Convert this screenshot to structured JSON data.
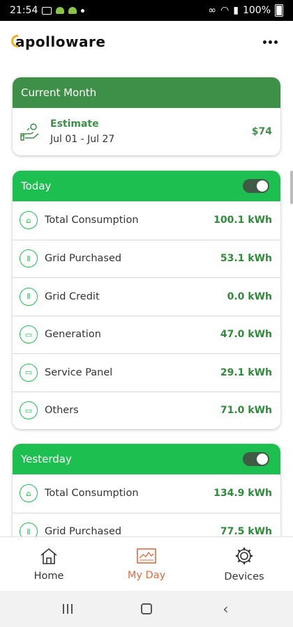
{
  "status_bar": {
    "time": "21:54",
    "battery": "100%"
  },
  "app": {
    "logo_text": "apolloware",
    "brand_color": "#f2b01e",
    "accent": "#3e8f47",
    "accent_bright": "#1cbf50"
  },
  "current_month": {
    "title": "Current Month",
    "estimate_label": "Estimate",
    "dates": "Jul 01 - Jul 27",
    "amount": "$74",
    "icon": "hand-money-icon"
  },
  "today": {
    "title": "Today",
    "rows": [
      {
        "label": "Total Consumption",
        "value": "100.1 kWh",
        "icon": "home-icon"
      },
      {
        "label": "Grid Purchased",
        "value": "53.1 kWh",
        "icon": "grid-tower-icon"
      },
      {
        "label": "Grid Credit",
        "value": "0.0 kWh",
        "icon": "grid-tower-icon"
      },
      {
        "label": "Generation",
        "value": "47.0 kWh",
        "icon": "panel-icon"
      },
      {
        "label": "Service Panel",
        "value": "29.1 kWh",
        "icon": "panel-icon"
      },
      {
        "label": "Others",
        "value": "71.0 kWh",
        "icon": "panel-icon"
      }
    ]
  },
  "yesterday": {
    "title": "Yesterday",
    "rows": [
      {
        "label": "Total Consumption",
        "value": "134.9 kWh",
        "icon": "home-icon"
      },
      {
        "label": "Grid Purchased",
        "value": "77.5 kWh",
        "icon": "grid-tower-icon"
      }
    ]
  },
  "nav": [
    {
      "label": "Home",
      "icon": "home-icon"
    },
    {
      "label": "My Day",
      "icon": "chart-icon",
      "active": true
    },
    {
      "label": "Devices",
      "icon": "gear-icon"
    }
  ]
}
